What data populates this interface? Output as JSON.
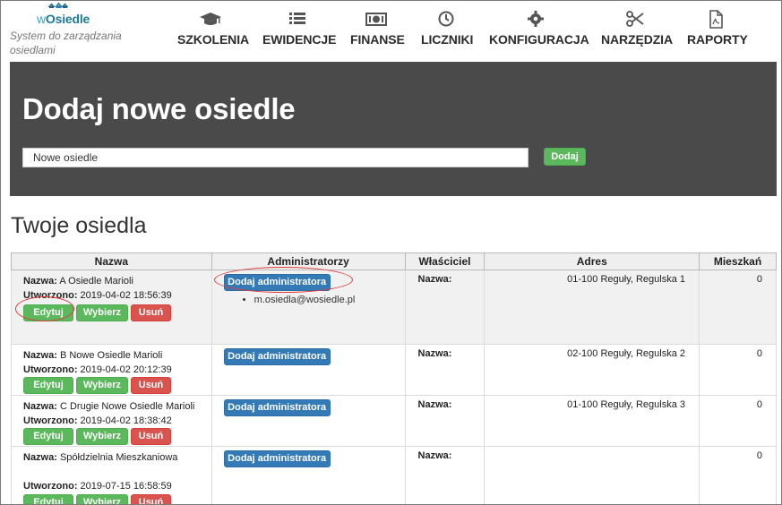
{
  "app": {
    "logo_text_w": "w",
    "logo_text": "Osiedle",
    "tagline": "System do zarządzania osiedlami"
  },
  "nav": [
    {
      "label": "SZKOLENIA",
      "icon": "graduation-cap-icon"
    },
    {
      "label": "EWIDENCJE",
      "icon": "list-icon"
    },
    {
      "label": "FINANSE",
      "icon": "money-icon"
    },
    {
      "label": "LICZNIKI",
      "icon": "clock-icon"
    },
    {
      "label": "KONFIGURACJA",
      "icon": "gear-icon"
    },
    {
      "label": "NARZĘDZIA",
      "icon": "scissors-icon"
    },
    {
      "label": "RAPORTY",
      "icon": "pdf-file-icon"
    }
  ],
  "hero": {
    "title": "Dodaj nowe osiedle",
    "input_value": "Nowe osiedle",
    "add_label": "Dodaj"
  },
  "section_title": "Twoje osiedla",
  "table": {
    "headers": [
      "Nazwa",
      "Administratorzy",
      "Właściciel",
      "Adres",
      "Mieszkań"
    ],
    "name_label": "Nazwa:",
    "created_label": "Utworzono:",
    "owner_label": "Nazwa:",
    "edit_label": "Edytuj",
    "pick_label": "Wybierz",
    "delete_label": "Usuń",
    "add_admin_label": "Dodaj administratora",
    "rows": [
      {
        "name": "A Osiedle Marioli",
        "created": "2019-04-02 18:56:39",
        "admins": [
          "m.osiedla@wosiedle.pl"
        ],
        "address": "01-100 Reguły, Regulska 1",
        "flats": "0"
      },
      {
        "name": "B Nowe Osiedle Marioli",
        "created": "2019-04-02 20:12:39",
        "admins": [],
        "address": "02-100 Reguły, Regulska 2",
        "flats": "0"
      },
      {
        "name": "C Drugie Nowe Osiedle Marioli",
        "created": "2019-04-02 18:38:42",
        "admins": [],
        "address": "01-100 Reguły, Regulska 3",
        "flats": "0"
      },
      {
        "name": "Spółdzielnia Mieszkaniowa",
        "created": "2019-07-15 16:58:59",
        "admins": [],
        "address": "",
        "flats": "0"
      }
    ]
  },
  "colors": {
    "hero_bg": "#4a4a4a",
    "green": "#5cb85c",
    "red": "#d9534f",
    "blue": "#337ab7",
    "annotation": "#e03a3a"
  }
}
